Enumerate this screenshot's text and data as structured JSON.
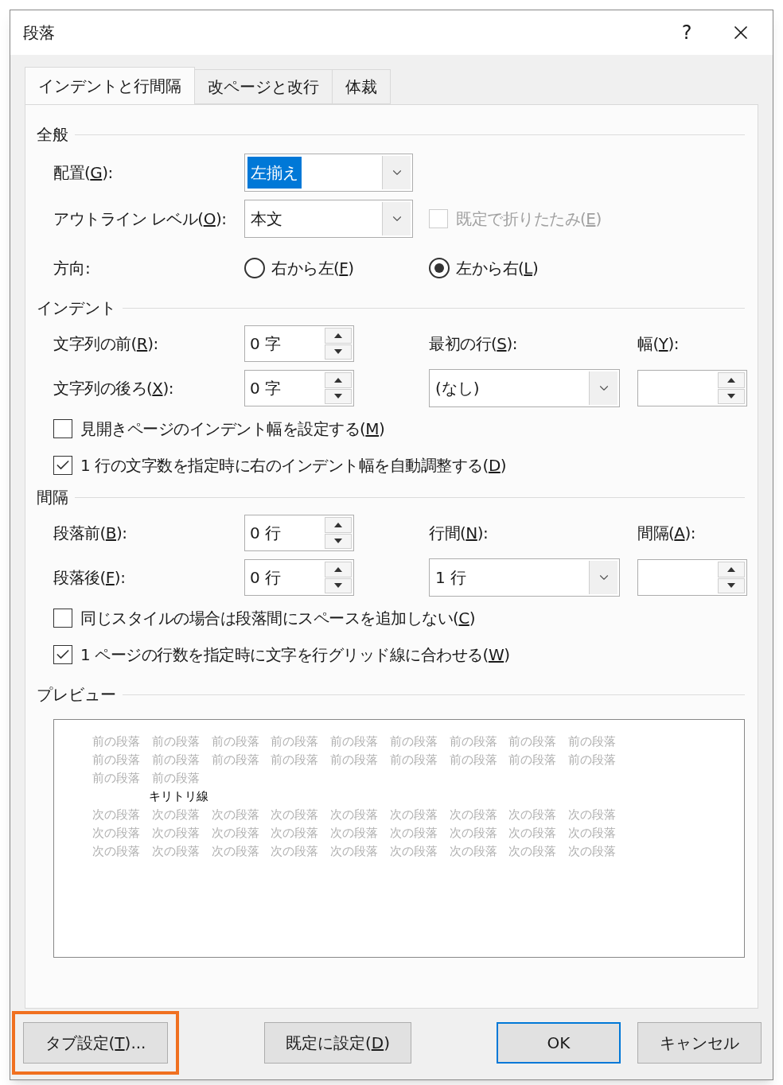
{
  "window": {
    "title": "段落",
    "help": "?"
  },
  "tabs": [
    {
      "label": "インデントと行間隔",
      "selected": true
    },
    {
      "label": "改ページと改行",
      "selected": false
    },
    {
      "label": "体裁",
      "selected": false
    }
  ],
  "general": {
    "title": "全般",
    "alignment": {
      "label": [
        "配置(",
        "G",
        "):"
      ],
      "value": "左揃え",
      "focused": true
    },
    "outline_level": {
      "label": [
        "アウトライン レベル(",
        "O",
        "):"
      ],
      "value": "本文",
      "focused": false
    },
    "collapsed": {
      "label": [
        "既定で折りたたみ(",
        "E",
        ")"
      ],
      "checked": false,
      "disabled": true
    },
    "direction": {
      "label": "方向:",
      "options": [
        {
          "label": [
            "右から左(",
            "F",
            ")"
          ],
          "selected": false
        },
        {
          "label": [
            "左から右(",
            "L",
            ")"
          ],
          "selected": true
        }
      ]
    }
  },
  "indent": {
    "title": "インデント",
    "before": {
      "label": [
        "文字列の前(",
        "R",
        "):"
      ],
      "value": "0 字"
    },
    "after": {
      "label": [
        "文字列の後ろ(",
        "X",
        "):"
      ],
      "value": "0 字"
    },
    "first_line": {
      "label": [
        "最初の行(",
        "S",
        "):"
      ],
      "value": "(なし)"
    },
    "width": {
      "label": [
        "幅(",
        "Y",
        "):"
      ]
    },
    "checkboxes": [
      {
        "label": [
          "見開きページのインデント幅を設定する(",
          "M",
          ")"
        ],
        "checked": false,
        "disabled": false
      },
      {
        "label": [
          "1 行の文字数を指定時に右のインデント幅を自動調整する(",
          "D",
          ")"
        ],
        "checked": true,
        "disabled": false
      }
    ]
  },
  "spacing": {
    "title": "間隔",
    "before": {
      "label": [
        "段落前(",
        "B",
        "):"
      ],
      "value": "0 行"
    },
    "after": {
      "label": [
        "段落後(",
        "F",
        "):"
      ],
      "value": "0 行"
    },
    "line_spacing": {
      "label": [
        "行間(",
        "N",
        "):"
      ],
      "value": "1 行"
    },
    "at": {
      "label": [
        "間隔(",
        "A",
        "):"
      ]
    },
    "checkboxes": [
      {
        "label": [
          "同じスタイルの場合は段落間にスペースを追加しない(",
          "C",
          ")"
        ],
        "checked": false,
        "disabled": false
      },
      {
        "label": [
          "1 ページの行数を指定時に文字を行グリッド線に合わせる(",
          "W",
          ")"
        ],
        "checked": true,
        "disabled": false
      }
    ]
  },
  "preview": {
    "title": "プレビュー",
    "before_lines": [
      "前の段落 前の段落 前の段落 前の段落 前の段落 前の段落 前の段落 前の段落 前の段落",
      "前の段落 前の段落 前の段落 前の段落 前の段落 前の段落 前の段落 前の段落 前の段落",
      "前の段落 前の段落"
    ],
    "sample": "キリトリ線",
    "after_lines": [
      "次の段落 次の段落 次の段落 次の段落 次の段落 次の段落 次の段落 次の段落 次の段落",
      "次の段落 次の段落 次の段落 次の段落 次の段落 次の段落 次の段落 次の段落 次の段落",
      "次の段落 次の段落 次の段落 次の段落 次の段落 次の段落 次の段落 次の段落 次の段落"
    ]
  },
  "buttons": [
    {
      "label": [
        "タブ設定(",
        "T",
        ")..."
      ],
      "default": false,
      "highlighted": true
    },
    {
      "label": [
        "既定に設定(",
        "D",
        ")"
      ],
      "default": false,
      "highlighted": false
    },
    {
      "label": [
        "OK"
      ],
      "default": true,
      "highlighted": false
    },
    {
      "label": [
        "キャンセル"
      ],
      "default": false,
      "highlighted": false
    }
  ]
}
